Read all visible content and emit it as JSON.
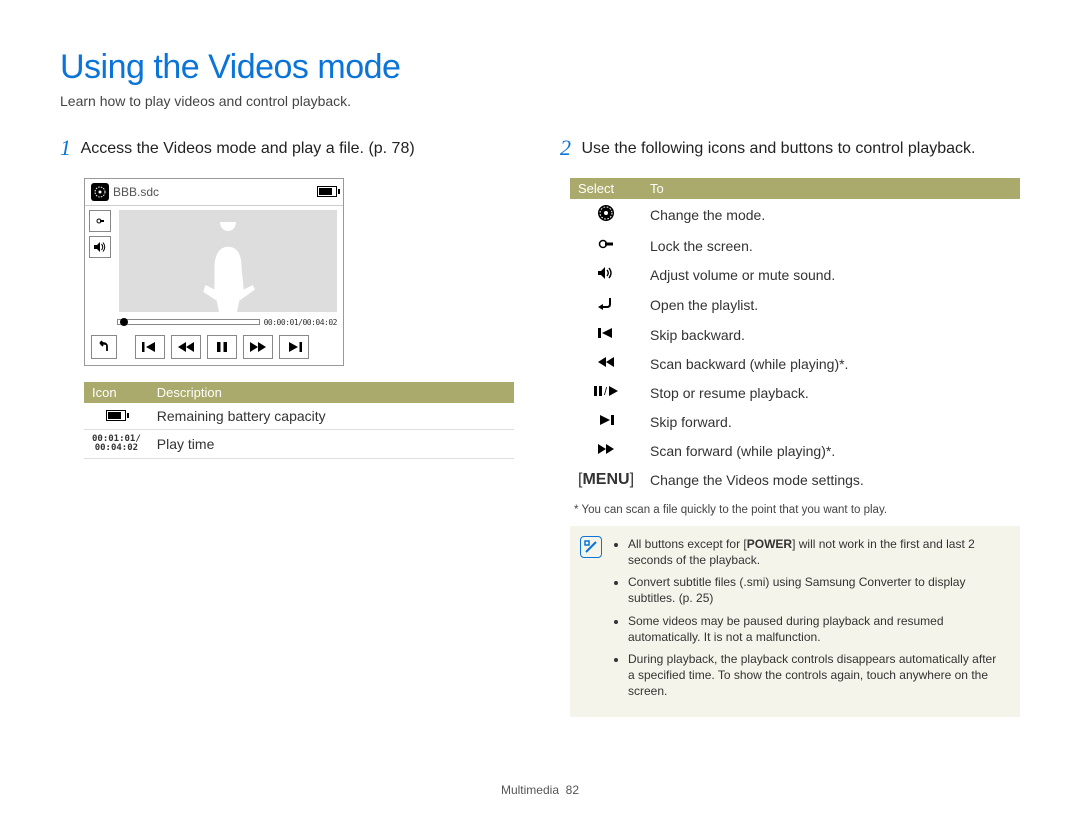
{
  "title": "Using the Videos mode",
  "subtitle": "Learn how to play videos and control playback.",
  "step1": {
    "num": "1",
    "text": "Access the Videos mode and play a file. (p. 78)"
  },
  "step2": {
    "num": "2",
    "text": "Use the following icons and buttons to control playback."
  },
  "device": {
    "filename": "BBB.sdc",
    "timecode": "00:00:01/00:04:02"
  },
  "icon_table": {
    "headers": {
      "c1": "Icon",
      "c2": "Description"
    },
    "rows": [
      {
        "icon_name": "battery-icon",
        "desc": "Remaining battery capacity"
      },
      {
        "icon_name": "play-time-icon",
        "icon_text_top": "00:01:01/",
        "icon_text_bot": "00:04:02",
        "desc": "Play time"
      }
    ]
  },
  "select_table": {
    "headers": {
      "c1": "Select",
      "c2": "To"
    },
    "rows": [
      {
        "icon_name": "mode-icon",
        "desc": "Change the mode."
      },
      {
        "icon_name": "lock-icon",
        "desc": "Lock the screen."
      },
      {
        "icon_name": "volume-icon",
        "desc": "Adjust volume or mute sound."
      },
      {
        "icon_name": "back-icon",
        "desc": "Open the playlist."
      },
      {
        "icon_name": "skip-backward-icon",
        "desc": "Skip backward."
      },
      {
        "icon_name": "scan-backward-icon",
        "desc": "Scan backward (while playing)*."
      },
      {
        "icon_name": "pause-play-icon",
        "desc": "Stop or resume playback."
      },
      {
        "icon_name": "skip-forward-icon",
        "desc": "Skip forward."
      },
      {
        "icon_name": "scan-forward-icon",
        "desc": "Scan forward (while playing)*."
      },
      {
        "icon_name": "menu-icon",
        "icon_text": "MENU",
        "desc": "Change the Videos mode settings."
      }
    ]
  },
  "footnote": "* You can scan a file quickly to the point that you want to play.",
  "notes": {
    "items": [
      {
        "pre": "All buttons except for [",
        "bold": "POWER",
        "post": "] will not work in the first and last 2 seconds of the playback."
      },
      {
        "text": "Convert subtitle files (.smi) using Samsung Converter to display subtitles. (p. 25)"
      },
      {
        "text": "Some videos may be paused during playback and resumed automatically. It is not a malfunction."
      },
      {
        "text": "During playback, the playback controls disappears automatically after a specified time. To show the controls again, touch anywhere on the screen."
      }
    ]
  },
  "footer": {
    "section": "Multimedia",
    "page": "82"
  }
}
